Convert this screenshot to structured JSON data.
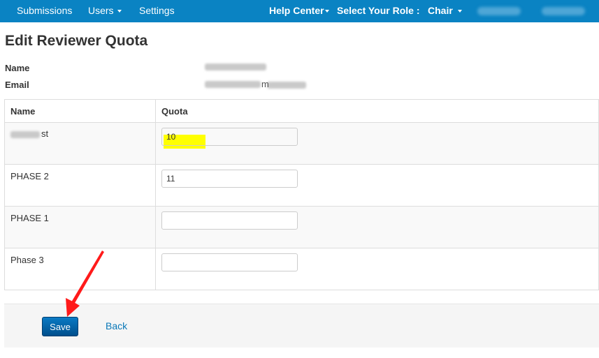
{
  "nav": {
    "submissions": "Submissions",
    "users": "Users",
    "settings": "Settings",
    "help_center": "Help Center",
    "select_role_label": "Select Your Role :",
    "role": "Chair"
  },
  "page": {
    "title": "Edit Reviewer Quota",
    "name_label": "Name",
    "email_label": "Email",
    "email_visible_tail": "m"
  },
  "table": {
    "headers": [
      "Name",
      "Quota"
    ],
    "rows": [
      {
        "name_visible": "st",
        "quota": "10"
      },
      {
        "name_visible": "PHASE 2",
        "quota": "11"
      },
      {
        "name_visible": "PHASE 1",
        "quota": ""
      },
      {
        "name_visible": "Phase 3",
        "quota": ""
      }
    ]
  },
  "actions": {
    "save_label": "Save",
    "back_label": "Back"
  },
  "colors": {
    "navbar": "#0a83c3",
    "primary_button": "#005fa3",
    "link": "#0a78b8",
    "highlight": "#ffff00",
    "annotation_arrow": "#ff1a1a"
  }
}
